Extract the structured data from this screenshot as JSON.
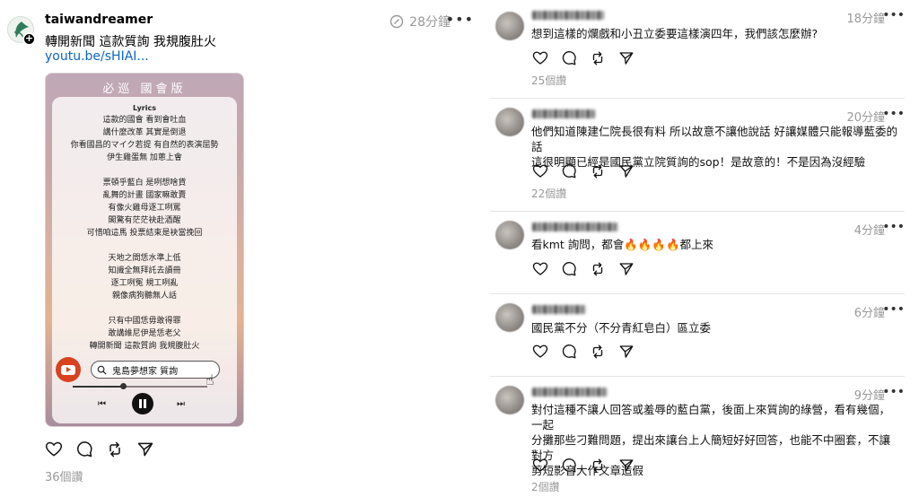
{
  "post": {
    "username": "taiwandreamer",
    "time": "28分鐘",
    "text": "轉開新聞 這款質詢 我規腹肚火",
    "link": "youtu.be/sHIAI...",
    "video": {
      "header": "必巡 國會版",
      "lyrics_title": "Lyrics",
      "lyrics": [
        "這款的國會 看到會吐血",
        "講什麼改革 其實是倒退",
        "你看國昌的マイク若提 有自然的表演屈勢",
        "伊生雞蛋無 加蔥上會",
        "",
        "票頓乎藍白 是咧想啥貨",
        "亂舞的計畫 國家嘛敢賣",
        "有像火雞母逐工咧罵",
        "閣驚有茫茫袂赴酒醒",
        "可惜咱這馬 投票結束是袂當挽回",
        "",
        "天地之間恁水準上低",
        "知識全無拜託去讀冊",
        "逐工咧冤 規工咧亂",
        "親像病狗聽無人話",
        "",
        "只有中國恁毋敢得罪",
        "敢講維尼伊是恁老父",
        "轉開新聞 這款質詢 我規腹肚火"
      ],
      "search_text": "鬼島夢想家 質詢",
      "progress": 0.37
    },
    "views": "36個讚",
    "icons": {
      "time": "edit-clock-icon",
      "more": "more-icon",
      "like": "heart-icon",
      "comment": "comment-icon",
      "repost": "repost-icon",
      "share": "send-icon"
    }
  },
  "comments": [
    {
      "time": "18分鐘",
      "text": "想到這樣的爛戲和小丑立委要這樣演四年，我們該怎麼辦?",
      "likes": "25個讚"
    },
    {
      "time": "20分鐘",
      "text": "他們知道陳建仁院長很有料 所以故意不讓他說話 好讓媒體只能報導藍委的話\n這很明顯已經是國民黨立院質詢的sop！是故意的！不是因為沒經驗",
      "likes": "22個讚"
    },
    {
      "time": "4分鐘",
      "text": "看kmt 詢問，都會🔥🔥🔥🔥都上來",
      "likes": ""
    },
    {
      "time": "6分鐘",
      "text": "國民黨不分（不分青紅皂白）區立委",
      "likes": ""
    },
    {
      "time": "9分鐘",
      "text": "對付這種不讓人回答或羞辱的藍白黨，後面上來質詢的綠營，看有幾個，一起\n分攤那些刁難問題，提出來讓台上人簡短好好回答，也能不中圈套，不讓對方\n剪短影音大作文章造假",
      "likes": "2個讚"
    }
  ]
}
